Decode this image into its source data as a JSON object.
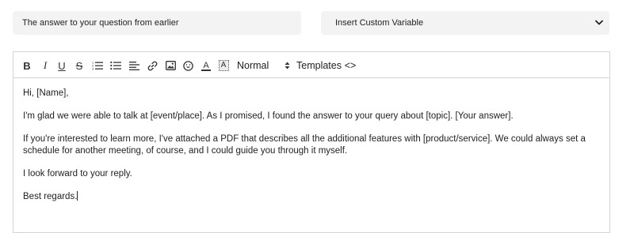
{
  "subject": {
    "value": "The answer to your question from earlier"
  },
  "variable_select": {
    "selected": "Insert Custom Variable"
  },
  "toolbar": {
    "bold": "B",
    "italic": "I",
    "underline": "U",
    "strike": "S",
    "text_color_glyph": "A",
    "highlight_glyph": "A",
    "format_select": "Normal",
    "templates_label": "Templates",
    "code_label": "<>"
  },
  "body": {
    "greeting": "Hi, [Name],",
    "paragraph1": "I'm glad we were able to talk at [event/place]. As I promised, I found the answer to your query about [topic]. [Your answer].",
    "paragraph2": "If you're interested to learn more, I've attached a PDF that describes all the additional features with [product/service]. We could always set a schedule for another meeting, of course, and I could guide you through it myself.",
    "paragraph3": "I look forward to your reply.",
    "signoff": "Best regards."
  },
  "icons": {
    "bold": "bold-icon",
    "italic": "italic-icon",
    "underline": "underline-icon",
    "strike": "strikethrough-icon",
    "ordered_list": "ordered-list-icon",
    "bullet_list": "bullet-list-icon",
    "align": "align-left-icon",
    "link": "link-icon",
    "image": "image-icon",
    "emoji": "emoji-icon",
    "text_color": "text-color-icon",
    "highlight": "highlight-icon",
    "sort": "sort-arrows-icon",
    "chevron": "chevron-down-icon"
  }
}
